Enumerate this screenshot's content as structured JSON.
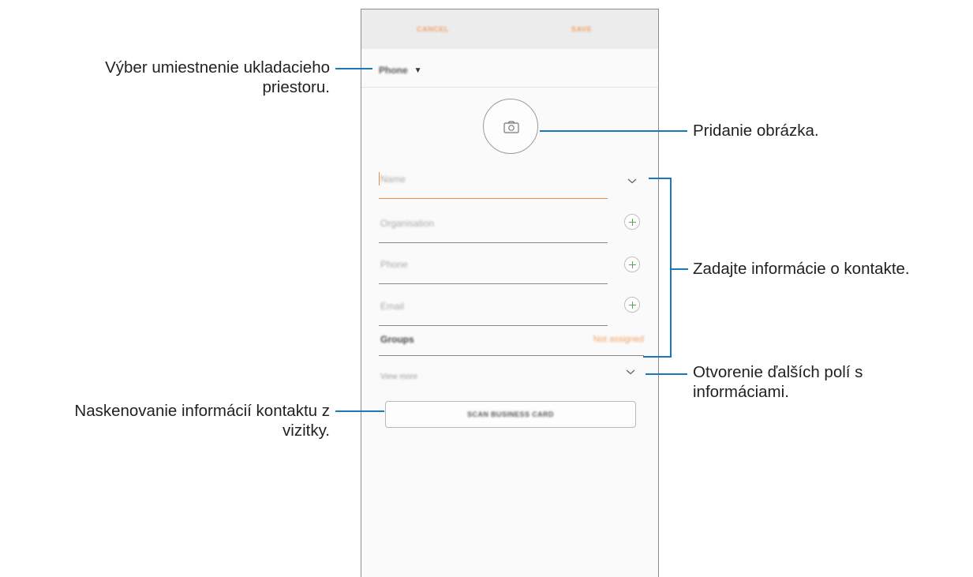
{
  "phone_screen": {
    "topbar": {
      "cancel_label": "CANCEL",
      "save_label": "SAVE"
    },
    "storage": {
      "label": "Phone"
    },
    "avatar": {
      "icon": "camera-icon"
    },
    "fields": {
      "name_placeholder": "Name",
      "organisation_placeholder": "Organisation",
      "phone_placeholder": "Phone",
      "email_placeholder": "Email"
    },
    "groups": {
      "label": "Groups",
      "value": "Not assigned"
    },
    "view_more": {
      "label": "View more"
    },
    "scan_button_label": "SCAN BUSINESS CARD"
  },
  "callouts": {
    "storage": {
      "line1": "Výber umiestnenie ukladacieho",
      "line2": "priestoru."
    },
    "add_image": "Pridanie obrázka.",
    "enter_contact": "Zadajte informácie o kontakte.",
    "more_fields": {
      "line1": "Otvorenie ďalších polí s",
      "line2": "informáciami."
    },
    "scan_card": {
      "line1": "Naskenovanie informácií kontaktu z",
      "line2": "vizitky."
    }
  },
  "colors": {
    "accent": "#f08a3c",
    "leader_line": "#1b77b8",
    "add_icon": "#5ba35b",
    "topbar_bg": "#ececec"
  }
}
